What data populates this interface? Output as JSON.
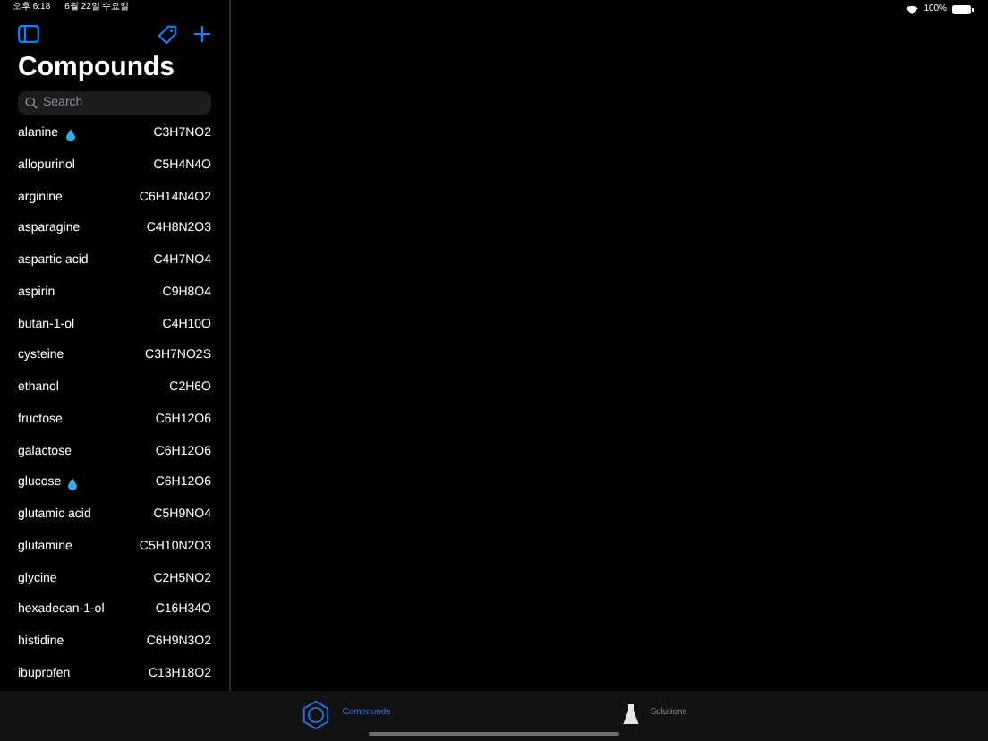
{
  "status_bar": {
    "time": "오후 6:18",
    "date": "6월 22일 수요일",
    "battery": "100%"
  },
  "sidebar": {
    "title": "Compounds",
    "search": {
      "placeholder": "Search"
    },
    "items": [
      {
        "name": "alanine",
        "formula": "C3H7NO2",
        "drop": true
      },
      {
        "name": "allopurinol",
        "formula": "C5H4N4O",
        "drop": false
      },
      {
        "name": "arginine",
        "formula": "C6H14N4O2",
        "drop": false
      },
      {
        "name": "asparagine",
        "formula": "C4H8N2O3",
        "drop": false
      },
      {
        "name": "aspartic acid",
        "formula": "C4H7NO4",
        "drop": false
      },
      {
        "name": "aspirin",
        "formula": "C9H8O4",
        "drop": false
      },
      {
        "name": "butan-1-ol",
        "formula": "C4H10O",
        "drop": false
      },
      {
        "name": "cysteine",
        "formula": "C3H7NO2S",
        "drop": false
      },
      {
        "name": "ethanol",
        "formula": "C2H6O",
        "drop": false
      },
      {
        "name": "fructose",
        "formula": "C6H12O6",
        "drop": false
      },
      {
        "name": "galactose",
        "formula": "C6H12O6",
        "drop": false
      },
      {
        "name": "glucose",
        "formula": "C6H12O6",
        "drop": true
      },
      {
        "name": "glutamic acid",
        "formula": "C5H9NO4",
        "drop": false
      },
      {
        "name": "glutamine",
        "formula": "C5H10N2O3",
        "drop": false
      },
      {
        "name": "glycine",
        "formula": "C2H5NO2",
        "drop": false
      },
      {
        "name": "hexadecan-1-ol",
        "formula": "C16H34O",
        "drop": false
      },
      {
        "name": "histidine",
        "formula": "C6H9N3O2",
        "drop": false
      },
      {
        "name": "ibuprofen",
        "formula": "C13H18O2",
        "drop": false
      }
    ]
  },
  "tab_bar": [
    {
      "label": "Compounds",
      "kind": "ring",
      "selected": true
    },
    {
      "label": "Solutions",
      "kind": "flask",
      "selected": false
    }
  ]
}
